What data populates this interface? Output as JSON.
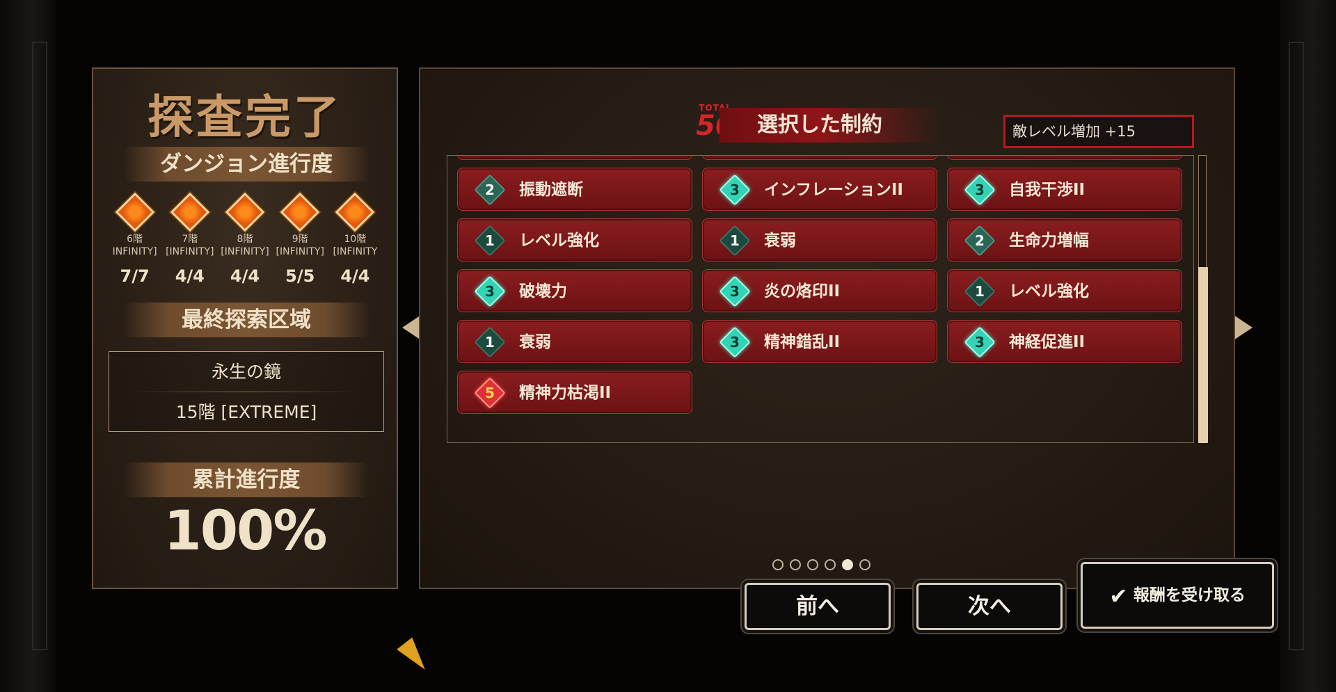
{
  "left_panel": {
    "title": "探査完了",
    "dungeon_progress_header": "ダンジョン進行度",
    "floors": [
      {
        "name": "6階",
        "difficulty": "INFINITY]",
        "count": "7/7"
      },
      {
        "name": "7階",
        "difficulty": "[INFINITY]",
        "count": "4/4"
      },
      {
        "name": "8階",
        "difficulty": "[INFINITY]",
        "count": "4/4"
      },
      {
        "name": "9階",
        "difficulty": "[INFINITY]",
        "count": "5/5"
      },
      {
        "name": "10階",
        "difficulty": "[INFINITY",
        "count": "4/4"
      }
    ],
    "last_area_header": "最終探索区域",
    "last_area_name": "永生の鏡",
    "last_area_floor": "15階 [EXTREME]",
    "cumulative_header": "累計進行度",
    "cumulative_value": "100%"
  },
  "right_panel": {
    "total_label": "TOTAL",
    "total_value": "50",
    "restrictions_title": "選択した制約",
    "enemy_level_text": "敵レベル増加 +15",
    "restrictions": [
      {
        "level": "2",
        "name": "振動遮断"
      },
      {
        "level": "3",
        "name": "インフレーションII"
      },
      {
        "level": "3",
        "name": "自我干渉II"
      },
      {
        "level": "1",
        "name": "レベル強化"
      },
      {
        "level": "1",
        "name": "衰弱"
      },
      {
        "level": "2",
        "name": "生命力増幅"
      },
      {
        "level": "3",
        "name": "破壊力"
      },
      {
        "level": "3",
        "name": "炎の烙印II"
      },
      {
        "level": "1",
        "name": "レベル強化"
      },
      {
        "level": "1",
        "name": "衰弱"
      },
      {
        "level": "3",
        "name": "精神錯乱II"
      },
      {
        "level": "3",
        "name": "神経促進II"
      },
      {
        "level": "5",
        "name": "精神力枯渇II"
      }
    ],
    "scroll_position": 0.65,
    "page_count": 6,
    "current_page": 5
  },
  "buttons": {
    "prev_label": "前へ",
    "next_label": "次へ",
    "claim_label": "報酬を受け取る",
    "claim_icon": "check-icon"
  },
  "colors": {
    "card_red": "#7a1719",
    "accent_teal": "#33d4b6",
    "warning_red": "#b51a20",
    "gold": "#c99a68"
  }
}
